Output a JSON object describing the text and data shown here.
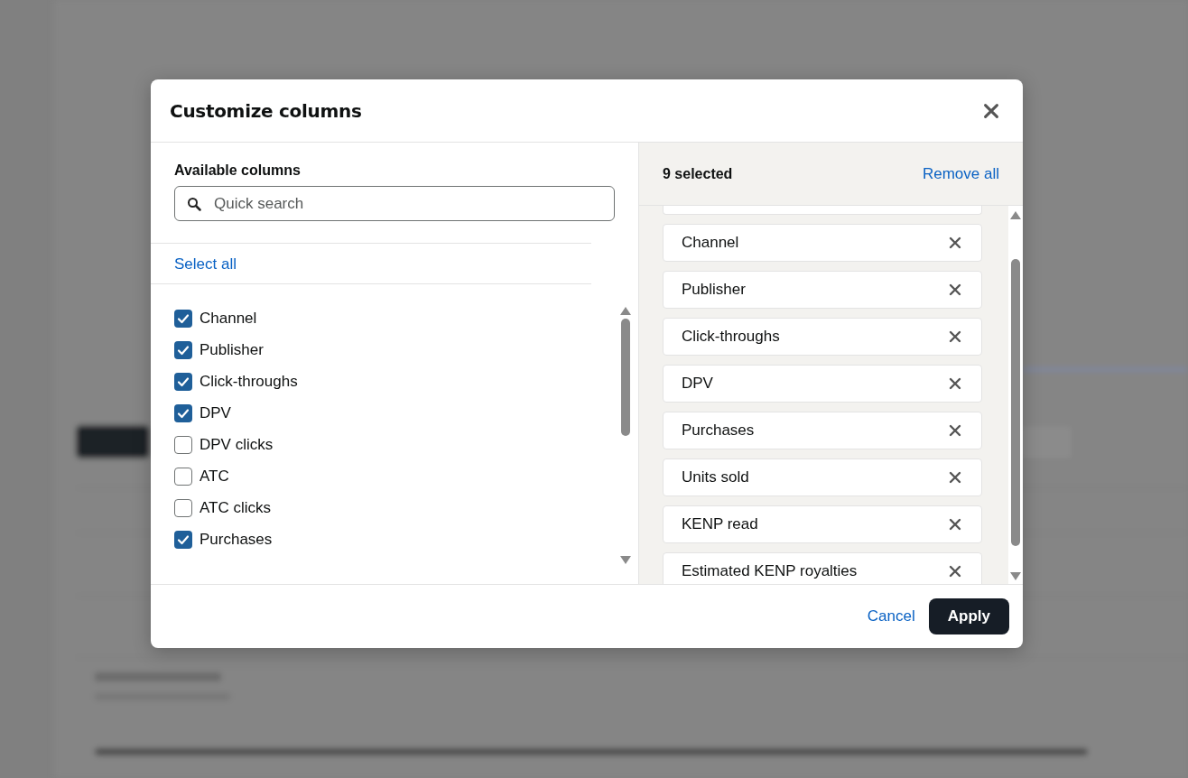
{
  "dialog": {
    "title": "Customize columns"
  },
  "available": {
    "heading": "Available columns",
    "search": {
      "placeholder": "Quick search"
    },
    "select_all": "Select all",
    "items": [
      {
        "label": "Channel",
        "checked": true
      },
      {
        "label": "Publisher",
        "checked": true
      },
      {
        "label": "Click-throughs",
        "checked": true
      },
      {
        "label": "DPV",
        "checked": true
      },
      {
        "label": "DPV clicks",
        "checked": false
      },
      {
        "label": "ATC",
        "checked": false
      },
      {
        "label": "ATC clicks",
        "checked": false
      },
      {
        "label": "Purchases",
        "checked": true
      }
    ]
  },
  "selected": {
    "count": "9 selected",
    "remove_all": "Remove all",
    "items": [
      {
        "label": "Channel"
      },
      {
        "label": "Publisher"
      },
      {
        "label": "Click-throughs"
      },
      {
        "label": "DPV"
      },
      {
        "label": "Purchases"
      },
      {
        "label": "Units sold"
      },
      {
        "label": "KENP read"
      },
      {
        "label": "Estimated KENP royalties"
      }
    ]
  },
  "buttons": {
    "cancel": "Cancel",
    "apply": "Apply"
  }
}
